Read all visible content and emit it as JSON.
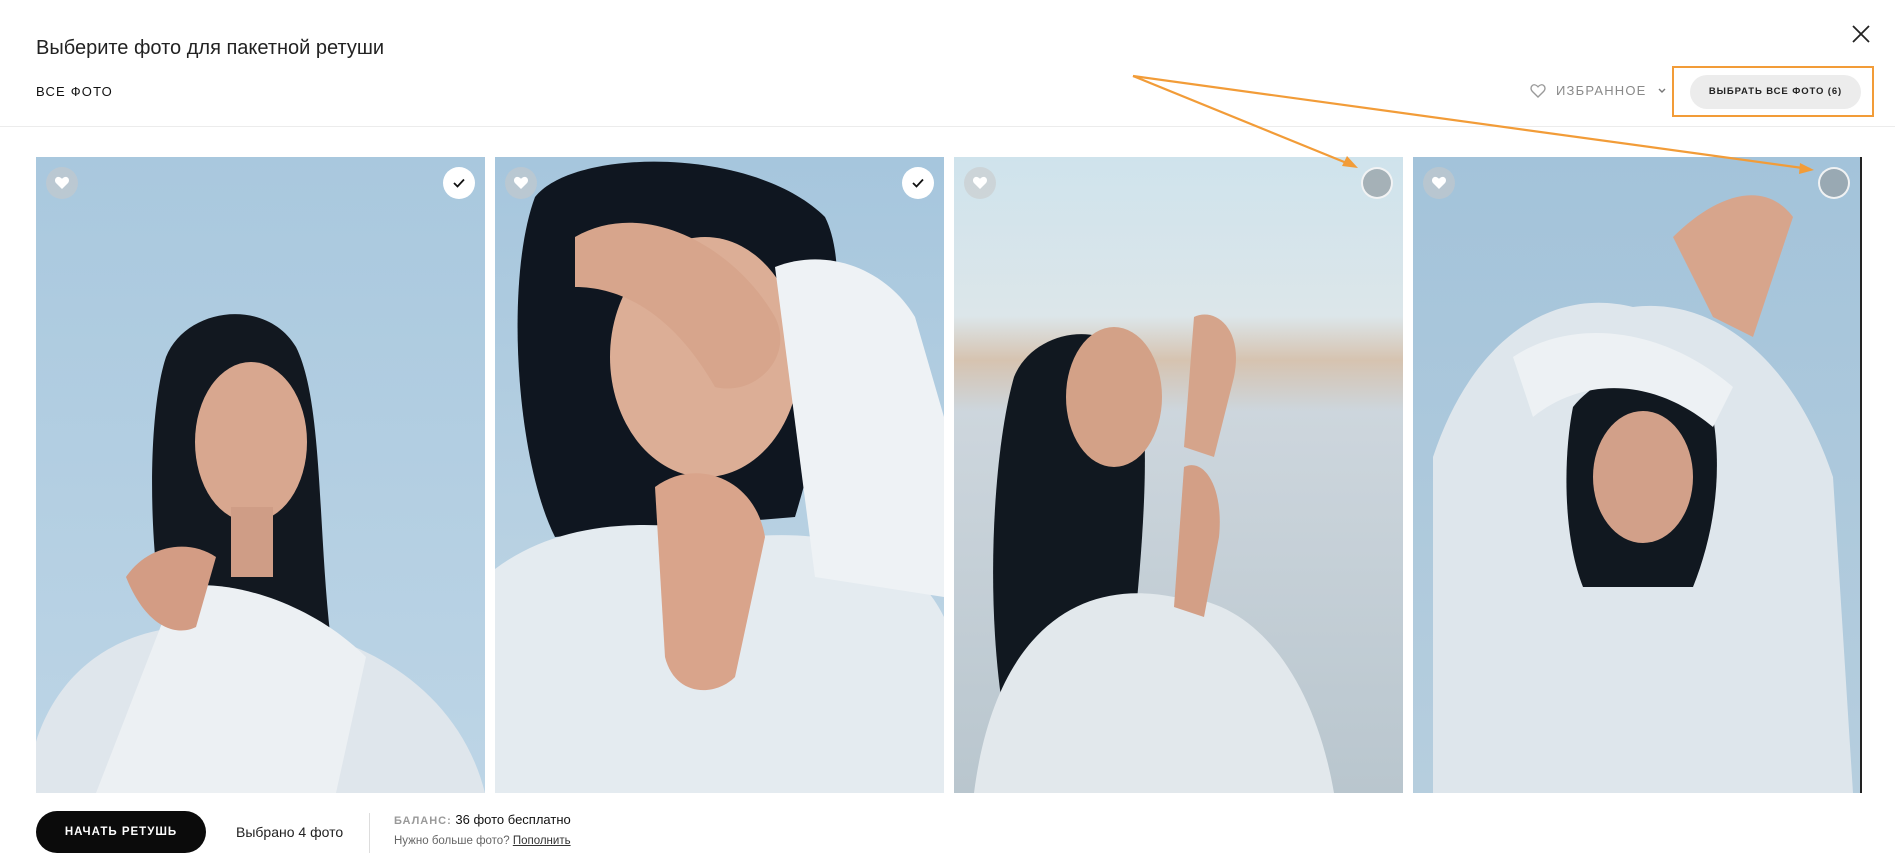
{
  "header": {
    "title": "Выберите фото для пакетной ретуши",
    "filter_all": "ВСЕ ФОТО",
    "favorites_filter": "ИЗБРАННОЕ",
    "select_all_label": "ВЫБРАТЬ ВСЕ ФОТО (6)"
  },
  "photos": [
    {
      "selected": true
    },
    {
      "selected": true
    },
    {
      "selected": false
    },
    {
      "selected": false
    }
  ],
  "footer": {
    "start_label": "НАЧАТЬ РЕТУШЬ",
    "selected_prefix": "Выбрано",
    "selected_count": "4",
    "selected_suffix": "фото",
    "balance_label": "БАЛАНС:",
    "balance_value": "36 фото бесплатно",
    "need_more": "Нужно больше фото?",
    "top_up_link": "Пополнить"
  },
  "colors": {
    "annotation": "#f29c38",
    "primary_button": "#0b0b0b",
    "secondary_button": "#ececec"
  },
  "icons": [
    "close-icon",
    "heart-outline-icon",
    "chevron-down-icon",
    "heart-icon",
    "check-icon"
  ]
}
